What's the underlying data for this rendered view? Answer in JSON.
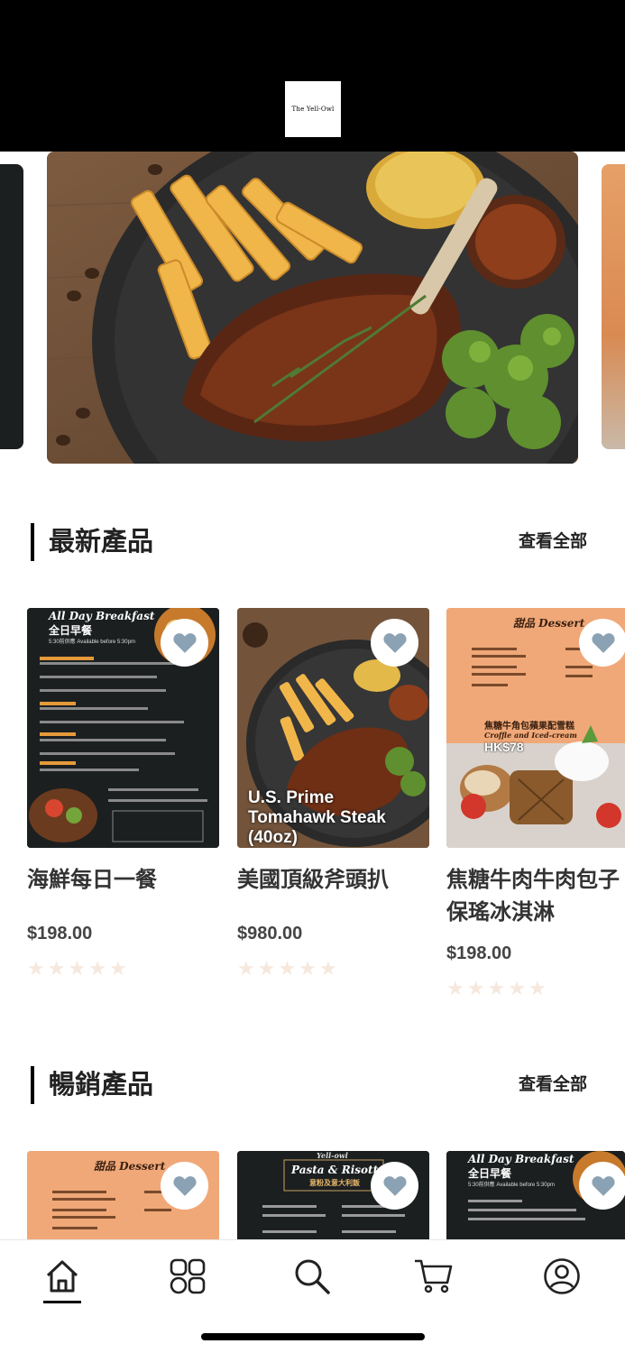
{
  "header": {
    "logo_text": "The Yell-Owl"
  },
  "sections": [
    {
      "title": "最新產品",
      "view_all": "查看全部"
    },
    {
      "title": "暢銷產品",
      "view_all": "查看全部"
    }
  ],
  "latest_products": [
    {
      "name": "海鮮每日一餐",
      "price": "$198.00",
      "rating": 0,
      "poster_title": "All Day Breakfast",
      "poster_subtitle": "全日早餐",
      "poster_note": "5:30前供應 Available before 5:30pm"
    },
    {
      "name": "美國頂級斧頭扒",
      "price": "$980.00",
      "rating": 0,
      "poster_title": "U.S. Prime Tomahawk Steak",
      "poster_subtitle": "(40oz)"
    },
    {
      "name": "焦糖牛肉牛肉包子保瑤冰淇淋",
      "price": "$198.00",
      "rating": 0,
      "poster_title": "甜品 Dessert",
      "poster_subtitle": "焦糖牛角包蘋果配雪糕",
      "poster_note": "Croffle and Iced-cream",
      "poster_price": "HK$78"
    }
  ],
  "bestseller_products": [
    {
      "poster_title": "甜品 Dessert"
    },
    {
      "poster_title": "Pasta & Risotto",
      "poster_subtitle": "意粉及意大利飯",
      "poster_note": "Yell-owl"
    },
    {
      "poster_title": "All Day Breakfast",
      "poster_subtitle": "全日早餐",
      "poster_note": "5:30前供應 Available before 5:30pm"
    }
  ],
  "nav": [
    {
      "name": "home",
      "icon": "home-icon",
      "active": true
    },
    {
      "name": "categories",
      "icon": "grid-icon",
      "active": false
    },
    {
      "name": "search",
      "icon": "search-icon",
      "active": false
    },
    {
      "name": "cart",
      "icon": "cart-icon",
      "active": false
    },
    {
      "name": "profile",
      "icon": "user-icon",
      "active": false
    }
  ],
  "colors": {
    "header_bg": "#000000",
    "star_empty": "#f6e8dc",
    "fav_heart": "#8aa2b3",
    "dessert_bg": "#f0a878",
    "menu_dark": "#1c1f20"
  }
}
